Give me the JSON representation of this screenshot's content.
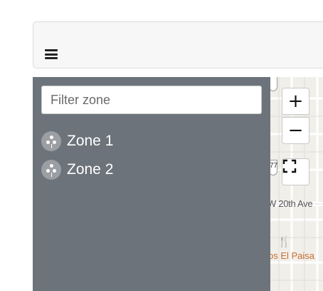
{
  "header": {
    "menu_icon": "hamburger-menu-icon"
  },
  "sidebar": {
    "filter": {
      "placeholder": "Filter zone",
      "value": ""
    },
    "zones": [
      {
        "label": "Zone 1",
        "icon": "zone-cluster-icon"
      },
      {
        "label": "Zone 2",
        "icon": "zone-cluster-icon"
      }
    ]
  },
  "map": {
    "zoom_in_label": "+",
    "zoom_out_label": "−",
    "fullscreen_icon": "fullscreen-icon",
    "route_shield_1": "",
    "route_shield_2": "77",
    "street_label": "W 20th Ave",
    "poi_label": "os El Paisa",
    "poi_icon": "restaurant-icon"
  },
  "colors": {
    "panel_bg": "#6c737b",
    "map_bg": "#f1efea",
    "poi_color": "#c76e2e"
  }
}
